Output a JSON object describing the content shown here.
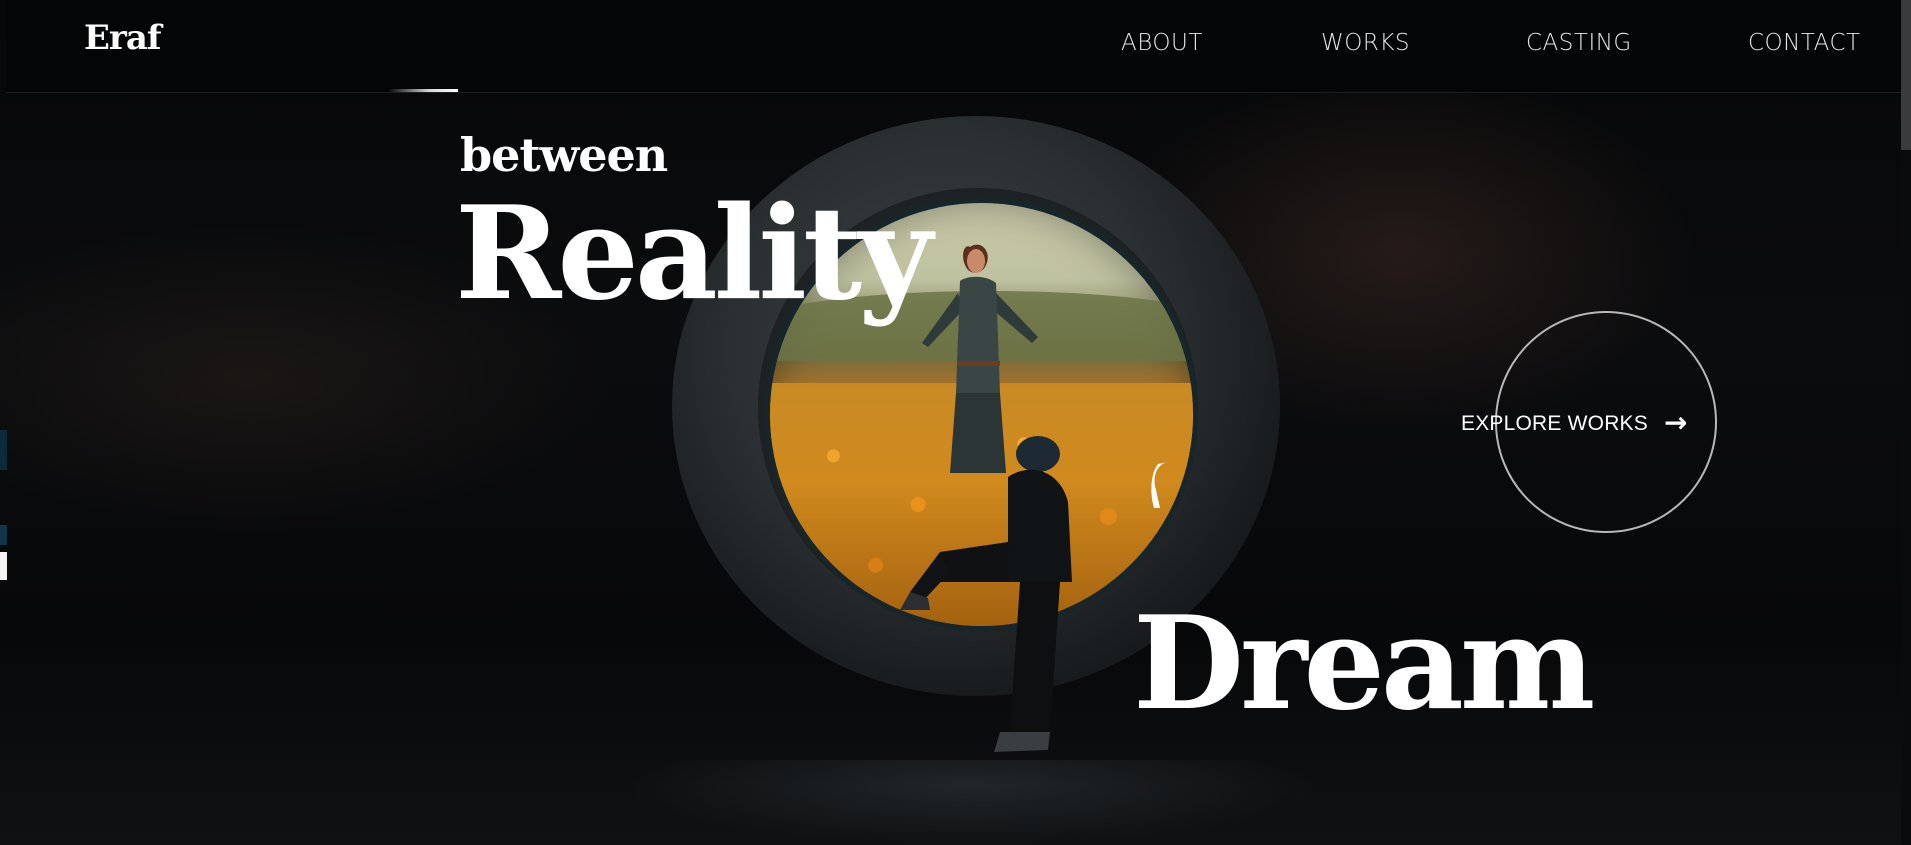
{
  "header": {
    "logo": "Eraf",
    "nav": {
      "about": "ABOUT",
      "works": "WORKS",
      "casting": "CASTING",
      "contact": "CONTACT"
    }
  },
  "hero": {
    "line1": "between",
    "line2": "Reality",
    "line3": "Dream"
  },
  "cta": {
    "label": "EXPLORE WORKS",
    "icon": "arrow-right-icon"
  },
  "colors": {
    "background": "#050607",
    "text": "#ffffff",
    "accent_orange": "#d08a1e"
  }
}
